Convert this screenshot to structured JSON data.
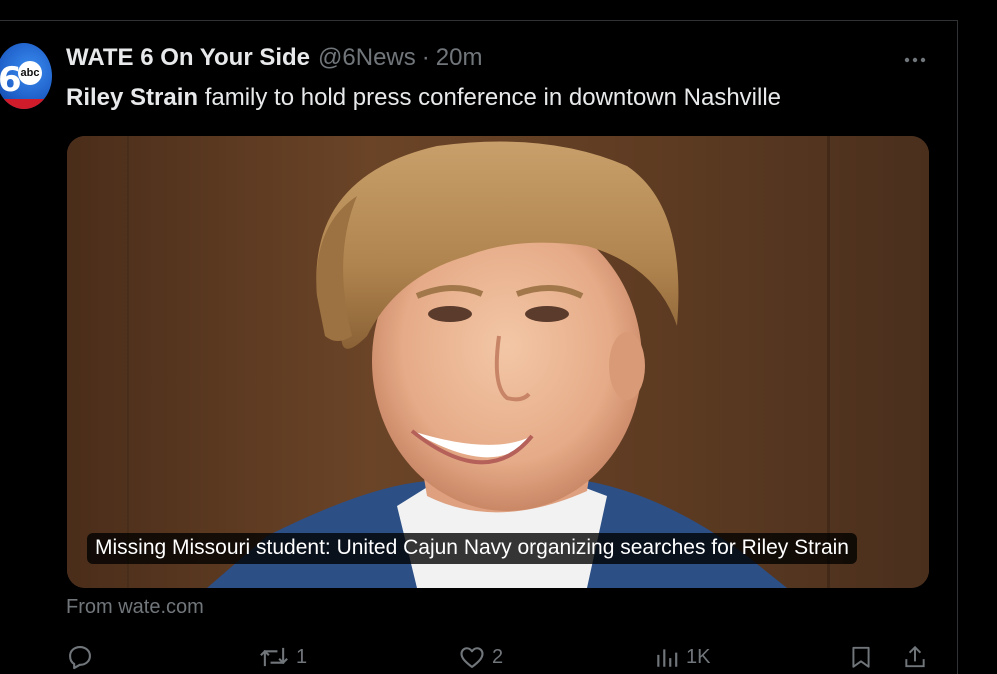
{
  "tweet": {
    "author_name": "WATE 6 On Your Side",
    "handle": "@6News",
    "separator": "·",
    "time": "20m",
    "avatar": {
      "number": "6",
      "network": "abc"
    },
    "text_bold": "Riley Strain",
    "text_rest": " family to hold press conference in downtown Nashville",
    "more_icon": "more-horizontal-icon"
  },
  "card": {
    "caption": "Missing Missouri student: United Cajun Navy organizing searches for Riley Strain",
    "source": "From wate.com"
  },
  "actions": {
    "reply": {
      "icon": "reply-icon",
      "count": ""
    },
    "retweet": {
      "icon": "retweet-icon",
      "count": "1"
    },
    "like": {
      "icon": "heart-icon",
      "count": "2"
    },
    "views": {
      "icon": "views-chart-icon",
      "count": "1K"
    },
    "bookmark": {
      "icon": "bookmark-icon"
    },
    "share": {
      "icon": "share-icon"
    }
  },
  "colors": {
    "background": "#000000",
    "text_primary": "#e7e9ea",
    "text_secondary": "#71767b",
    "divider": "#2f3336"
  }
}
